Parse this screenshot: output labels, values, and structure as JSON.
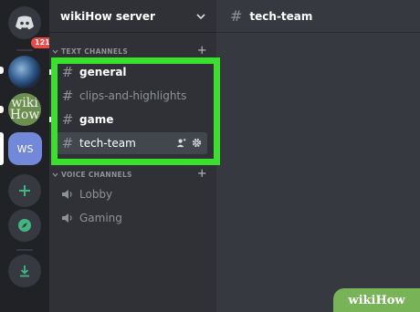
{
  "rail": {
    "home_badge": "121",
    "wiki_logo": "wiki How",
    "ws_label": "WS"
  },
  "sidebar": {
    "server_name": "wikiHow server",
    "text_category": "TEXT CHANNELS",
    "voice_category": "VOICE CHANNELS",
    "text_channels": [
      {
        "label": "general"
      },
      {
        "label": "clips-and-highlights"
      },
      {
        "label": "game"
      },
      {
        "label": "tech-team"
      }
    ],
    "voice_channels": [
      {
        "label": "Lobby"
      },
      {
        "label": "Gaming"
      }
    ]
  },
  "main": {
    "channel_title": "tech-team"
  },
  "watermark": "wikiHow",
  "colors": {
    "highlight": "#39e02c",
    "accent": "#7289da",
    "badge": "#f04747"
  }
}
